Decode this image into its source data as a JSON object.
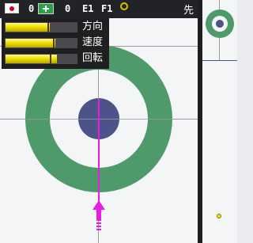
{
  "status": {
    "team1_score": "0",
    "team2_score": "0",
    "end_label": "E1",
    "frame_label": "F1",
    "turn_label": "先"
  },
  "gauges": [
    {
      "label": "方向",
      "level": 0.62,
      "marker": 0.6
    },
    {
      "label": "速度",
      "level": 0.7,
      "marker": 0.68
    },
    {
      "label": "回転",
      "level": 0.72,
      "marker": 0.63
    }
  ],
  "colors": {
    "ring_outer": "#4f9a6b",
    "button": "#4d5289",
    "aim_line": "#e61ee0",
    "gauge_fill": "#f4e600",
    "stone_yellow": "#f1df00"
  },
  "icons": [
    "japan-flag-icon",
    "team-flag-icon",
    "stone-indicator-icon",
    "aim-arrow-icon"
  ]
}
